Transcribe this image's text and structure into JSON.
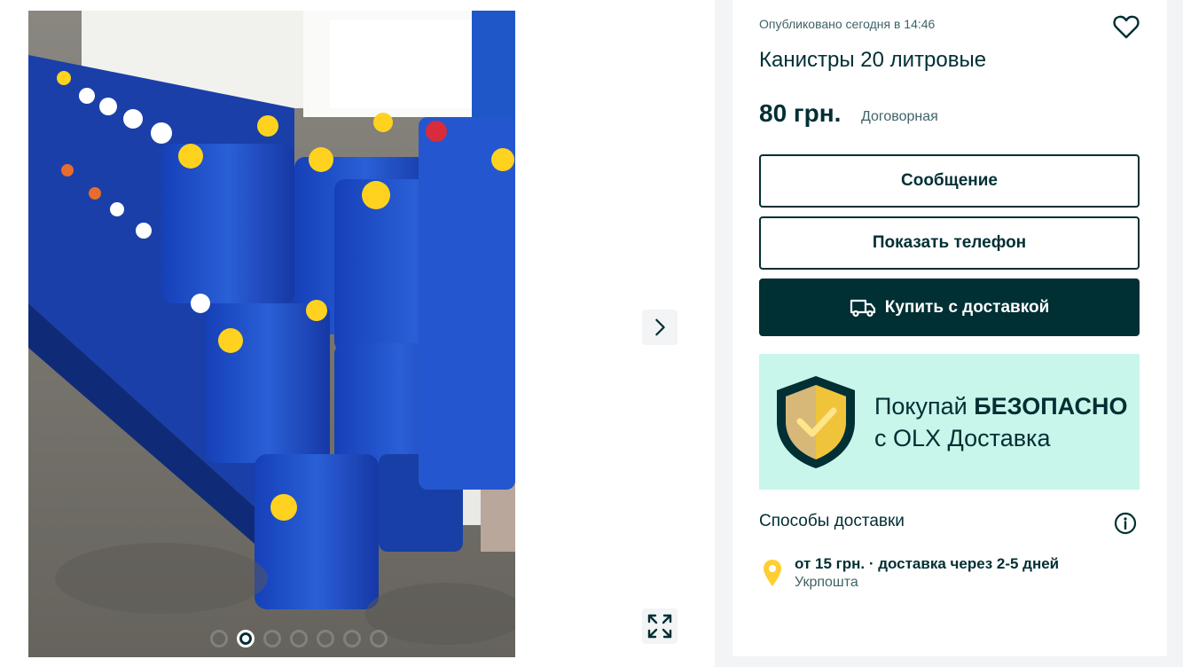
{
  "listing": {
    "posted": "Опубликовано сегодня в 14:46",
    "title": "Канистры 20 литровые",
    "price": "80 грн.",
    "negotiable": "Договорная"
  },
  "actions": {
    "message": "Сообщение",
    "show_phone": "Показать телефон",
    "buy_with_delivery": "Купить с доставкой"
  },
  "banner": {
    "line1_regular": "Покупай ",
    "line1_bold": "БЕЗОПАСНО",
    "line2": "с OLX Доставка"
  },
  "delivery": {
    "title": "Способы доставки",
    "option_line": "от 15 грн. · доставка через 2-5 дней",
    "carrier": "Укрпошта"
  },
  "gallery": {
    "photo_count": 7,
    "active_photo": 2,
    "photo_description": "photo of blue 20-liter plastic canisters with yellow caps"
  },
  "colors": {
    "primary": "#002f34",
    "banner_bg": "#c8f6ea",
    "pin": "#ffce32",
    "muted_text": "#406367"
  },
  "icons": [
    "heart-icon",
    "chevron-right-icon",
    "expand-icon",
    "truck-icon",
    "shield-check-icon",
    "info-icon",
    "location-pin-icon"
  ]
}
